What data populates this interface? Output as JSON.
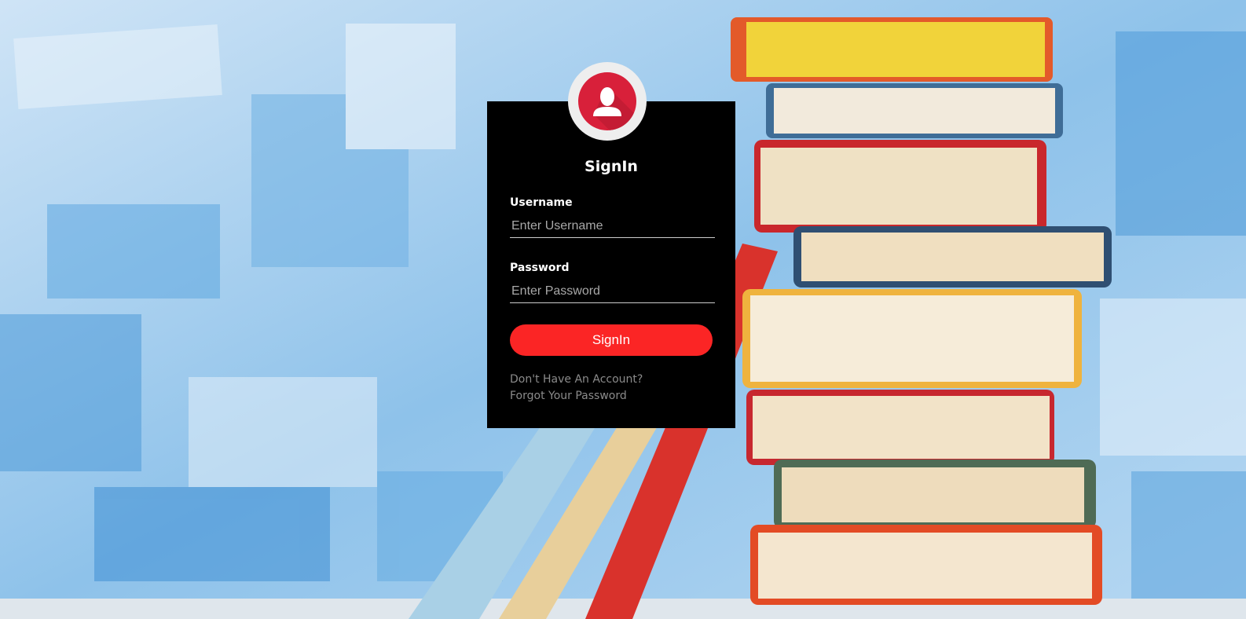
{
  "colors": {
    "card_background": "#000000",
    "button_background": "#fb2525",
    "button_text": "#ffffff",
    "avatar_accent": "#d8203a",
    "link_text": "#8b8b8b"
  },
  "avatar": {
    "icon": "user-icon"
  },
  "form": {
    "title": "SignIn",
    "username": {
      "label": "Username",
      "placeholder": "Enter Username",
      "value": ""
    },
    "password": {
      "label": "Password",
      "placeholder": "Enter Password",
      "value": ""
    },
    "submit_label": "SignIn"
  },
  "links": {
    "register": "Don't Have An Account?",
    "forgot": "Forgot Your Password"
  }
}
